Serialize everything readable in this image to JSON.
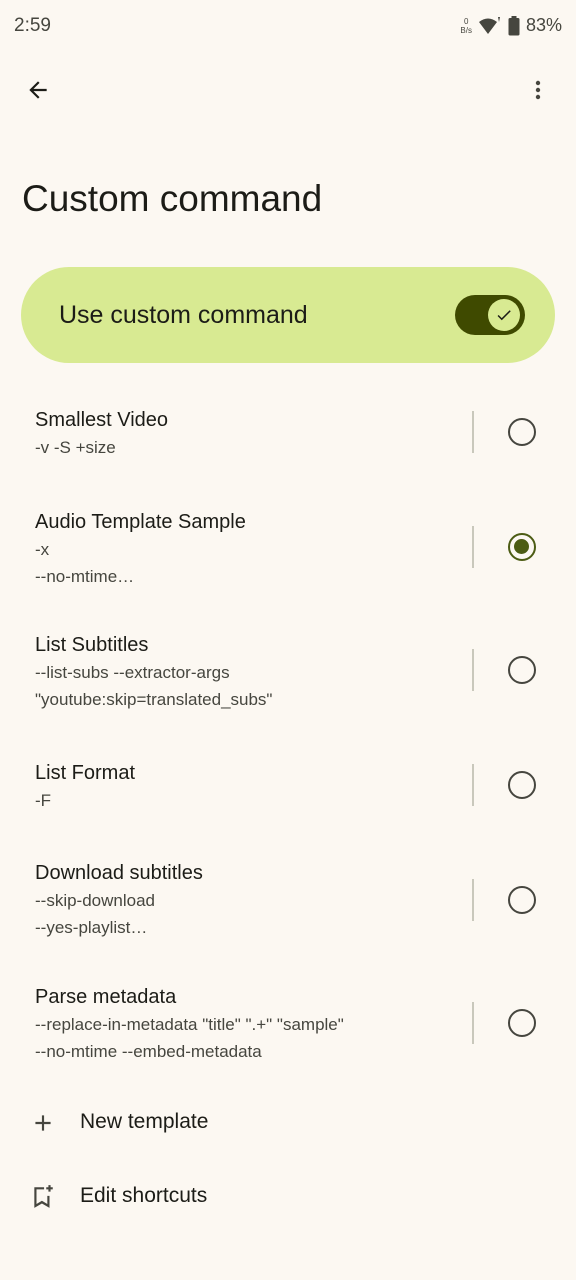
{
  "status_bar": {
    "time": "2:59",
    "net_speed_value": "0",
    "net_speed_unit": "B/s",
    "battery": "83%"
  },
  "top_bar": {
    "back_icon": "arrow-back-icon",
    "more_icon": "more-vert-icon"
  },
  "page": {
    "title": "Custom command"
  },
  "master_switch": {
    "label": "Use custom command",
    "checked": true,
    "accent": "#d8ea92",
    "track_color": "#3f4a00"
  },
  "templates": [
    {
      "title": "Smallest Video",
      "subtitle": "-v -S +size",
      "selected": false
    },
    {
      "title": "Audio Template Sample",
      "subtitle": "-x\n--no-mtime…",
      "selected": true
    },
    {
      "title": "List Subtitles",
      "subtitle": "--list-subs --extractor-args\n\"youtube:skip=translated_subs\"",
      "selected": false
    },
    {
      "title": "List Format",
      "subtitle": "-F",
      "selected": false
    },
    {
      "title": "Download subtitles",
      "subtitle": "--skip-download\n--yes-playlist…",
      "selected": false
    },
    {
      "title": "Parse metadata",
      "subtitle": "--replace-in-metadata \"title\" \".+\" \"sample\"\n--no-mtime --embed-metadata",
      "selected": false
    }
  ],
  "actions": [
    {
      "label": "New template",
      "icon": "plus-icon"
    },
    {
      "label": "Edit shortcuts",
      "icon": "bookmark-add-icon"
    }
  ],
  "colors": {
    "background": "#fcf8f2",
    "selected_radio": "#4c5c14"
  }
}
